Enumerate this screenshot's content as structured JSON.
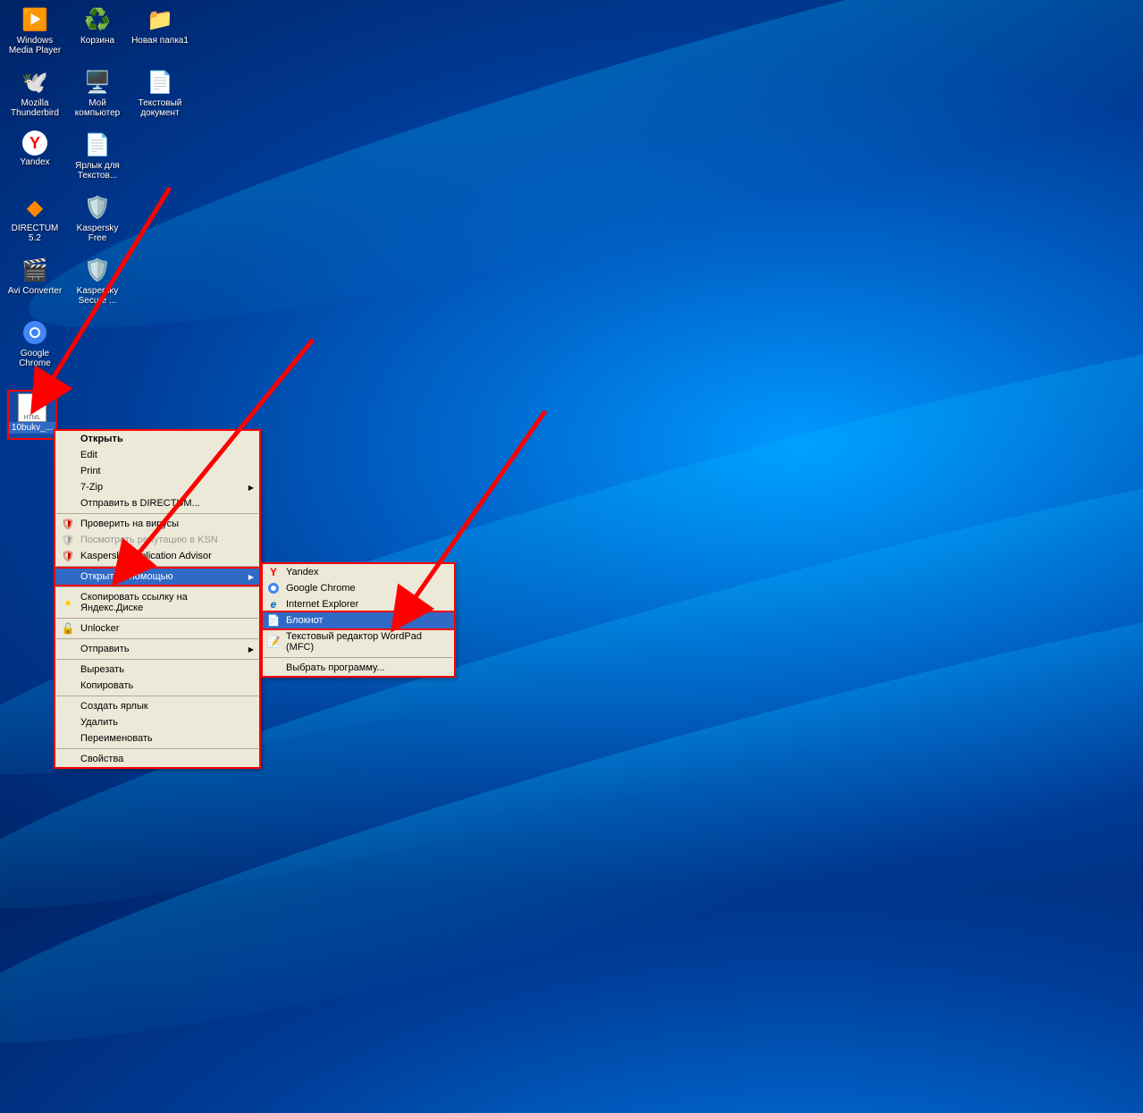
{
  "desktop": {
    "icons": [
      {
        "label": "Windows Media Player",
        "glyph": "▶"
      },
      {
        "label": "Корзина",
        "glyph": "🗑"
      },
      {
        "label": "Новая папка1",
        "glyph": "📁"
      },
      {
        "label": "Mozilla Thunderbird",
        "glyph": "✉"
      },
      {
        "label": "Мой компьютер",
        "glyph": "🖥"
      },
      {
        "label": "Текстовый документ",
        "glyph": "📄"
      },
      {
        "label": "Yandex",
        "glyph": "Y"
      },
      {
        "label": "Ярлык для Текстов...",
        "glyph": "📄"
      },
      {
        "label": "",
        "glyph": ""
      },
      {
        "label": "DIRECTUM 5.2",
        "glyph": "◆"
      },
      {
        "label": "Kaspersky Free",
        "glyph": "🛡"
      },
      {
        "label": "",
        "glyph": ""
      },
      {
        "label": "Avi Converter",
        "glyph": "🎬"
      },
      {
        "label": "Kaspersky Secure ...",
        "glyph": "🛡"
      },
      {
        "label": "",
        "glyph": ""
      },
      {
        "label": "Google Chrome",
        "glyph": "●"
      }
    ],
    "selected_file": {
      "label": "10bukv_...",
      "badge": "HTML"
    }
  },
  "context_menu": {
    "items": [
      {
        "label": "Открыть",
        "bold": true
      },
      {
        "label": "Edit"
      },
      {
        "label": "Print"
      },
      {
        "label": "7-Zip",
        "arrow": true
      },
      {
        "label": "Отправить в DIRECTUM..."
      }
    ],
    "items2": [
      {
        "label": "Проверить на вирусы",
        "icon": "🛡"
      },
      {
        "label": "Посмотреть репутацию в KSN",
        "icon": "🛡",
        "disabled": true
      },
      {
        "label": "Kaspersky Application Advisor",
        "icon": "🛡"
      }
    ],
    "open_with": {
      "label": "Открыть с помощью",
      "arrow": true
    },
    "items3": [
      {
        "label": "Скопировать ссылку на Яндекс.Диске",
        "icon": "●"
      }
    ],
    "items4": [
      {
        "label": "Unlocker",
        "icon": "🔓"
      }
    ],
    "items5": [
      {
        "label": "Отправить",
        "arrow": true
      }
    ],
    "items6": [
      {
        "label": "Вырезать"
      },
      {
        "label": "Копировать"
      }
    ],
    "items7": [
      {
        "label": "Создать ярлык"
      },
      {
        "label": "Удалить"
      },
      {
        "label": "Переименовать"
      }
    ],
    "items8": [
      {
        "label": "Свойства"
      }
    ]
  },
  "submenu": {
    "items": [
      {
        "label": "Yandex",
        "icon": "Y"
      },
      {
        "label": "Google Chrome",
        "icon": "●"
      },
      {
        "label": "Internet Explorer",
        "icon": "e"
      },
      {
        "label": "Блокнот",
        "icon": "📄",
        "highlighted": true
      },
      {
        "label": "Текстовый редактор WordPad (MFC)",
        "icon": "📝"
      }
    ],
    "choose": {
      "label": "Выбрать программу..."
    }
  }
}
